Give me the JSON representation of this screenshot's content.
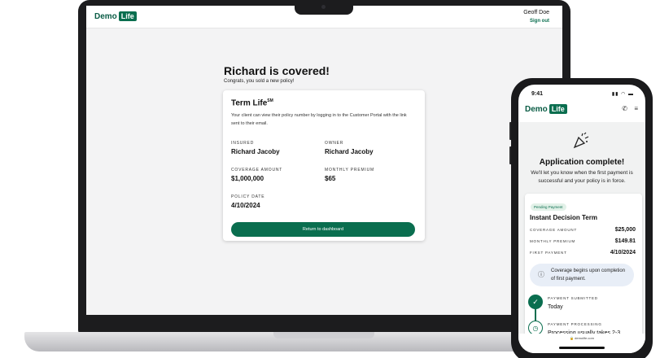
{
  "laptop": {
    "brand": {
      "name": "Demo",
      "tag": "Life"
    },
    "user": {
      "name": "Geoff Doe",
      "sign_out": "Sign out"
    },
    "headline": "Richard is covered!",
    "subheadline": "Congrats, you sold a new policy!",
    "card": {
      "title": "Term Life",
      "title_mark": "SM",
      "description": "Your client can view their policy number by logging in to the Customer Portal with the link sent to their email.",
      "fields": {
        "insured_label": "INSURED",
        "insured_value": "Richard Jacoby",
        "owner_label": "OWNER",
        "owner_value": "Richard Jacoby",
        "coverage_label": "COVERAGE AMOUNT",
        "coverage_value": "$1,000,000",
        "premium_label": "MONTHLY PREMIUM",
        "premium_value": "$65",
        "date_label": "POLICY DATE",
        "date_value": "4/10/2024"
      },
      "button": "Return to dashboard"
    }
  },
  "phone": {
    "time": "9:41",
    "status_icons": "signal wifi battery",
    "brand": {
      "name": "Demo",
      "tag": "Life"
    },
    "icons": {
      "call": "phone-icon",
      "menu": "menu-icon",
      "celebrate": "party-popper-icon"
    },
    "title": "Application complete!",
    "subtitle": "We'll let you know when the first payment is successful and your policy is in force.",
    "card": {
      "badge": "Pending Payment",
      "title": "Instant Decision Term",
      "rows": [
        {
          "label": "COVERAGE AMOUNT",
          "value": "$25,000"
        },
        {
          "label": "MONTHLY PREMIUM",
          "value": "$149.81"
        },
        {
          "label": "FIRST PAYMENT",
          "value": "4/10/2024"
        }
      ],
      "info": "Coverage begins upon completion of first payment.",
      "steps": [
        {
          "label": "PAYMENT SUBMITTED",
          "value": "Today",
          "state": "done"
        },
        {
          "label": "PAYMENT PROCESSING",
          "value": "Processing usually takes 2-3",
          "state": "pending"
        }
      ]
    },
    "url": "demolife.com"
  },
  "colors": {
    "brand_green": "#0a6e4f",
    "info_bg": "#e8eef7",
    "badge_bg": "#e2f1e8"
  }
}
